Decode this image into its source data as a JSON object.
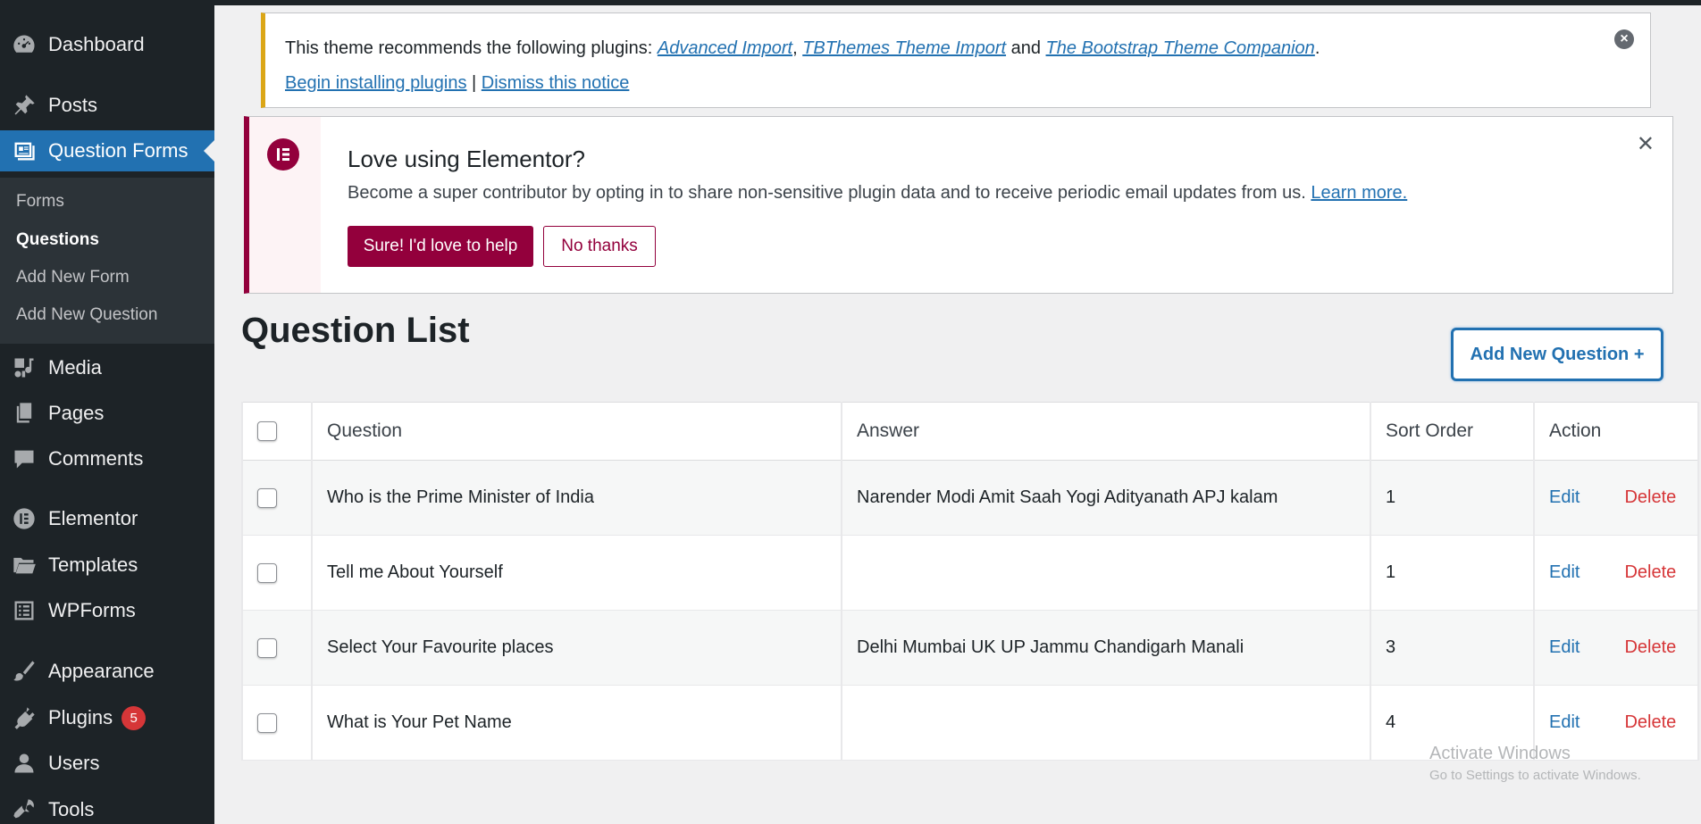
{
  "sidebar": {
    "items": [
      {
        "id": "dashboard",
        "label": "Dashboard",
        "icon": "dashboard-icon"
      },
      {
        "id": "posts",
        "label": "Posts",
        "icon": "pin-icon"
      },
      {
        "id": "question-forms",
        "label": "Question Forms",
        "icon": "forms-icon",
        "active": true
      },
      {
        "id": "media",
        "label": "Media",
        "icon": "media-icon"
      },
      {
        "id": "pages",
        "label": "Pages",
        "icon": "pages-icon"
      },
      {
        "id": "comments",
        "label": "Comments",
        "icon": "comment-icon"
      },
      {
        "id": "elementor",
        "label": "Elementor",
        "icon": "elementor-icon"
      },
      {
        "id": "templates",
        "label": "Templates",
        "icon": "folder-icon"
      },
      {
        "id": "wpforms",
        "label": "WPForms",
        "icon": "wpforms-icon"
      },
      {
        "id": "appearance",
        "label": "Appearance",
        "icon": "brush-icon"
      },
      {
        "id": "plugins",
        "label": "Plugins",
        "icon": "plug-icon",
        "badge": "5"
      },
      {
        "id": "users",
        "label": "Users",
        "icon": "user-icon"
      },
      {
        "id": "tools",
        "label": "Tools",
        "icon": "wrench-icon"
      }
    ],
    "submenu": [
      {
        "label": "Forms"
      },
      {
        "label": "Questions",
        "current": true
      },
      {
        "label": "Add New Form"
      },
      {
        "label": "Add New Question"
      }
    ]
  },
  "theme_notice": {
    "prefix": "This theme recommends the following plugins: ",
    "plugin1": "Advanced Import",
    "sep1": ", ",
    "plugin2": "TBThemes Theme Import",
    "sep2": " and ",
    "plugin3": "The Bootstrap Theme Companion",
    "end": ".",
    "begin_link": "Begin installing plugins",
    "pipe": " | ",
    "dismiss_link": "Dismiss this notice"
  },
  "elementor_notice": {
    "title": "Love using Elementor?",
    "description": "Become a super contributor by opting in to share non-sensitive plugin data and to receive periodic email updates from us. ",
    "learn_more": "Learn more.",
    "yes_button": "Sure! I'd love to help",
    "no_button": "No thanks"
  },
  "page": {
    "title": "Question List",
    "add_button": "Add New Question +"
  },
  "table": {
    "headers": {
      "question": "Question",
      "answer": "Answer",
      "sort": "Sort Order",
      "action": "Action"
    },
    "edit_label": "Edit",
    "delete_label": "Delete",
    "rows": [
      {
        "question": "Who is the Prime Minister of India",
        "answer": "Narender Modi Amit Saah Yogi Adityanath APJ kalam",
        "sort": "1"
      },
      {
        "question": "Tell me About Yourself",
        "answer": "",
        "sort": "1"
      },
      {
        "question": "Select Your Favourite places",
        "answer": "Delhi Mumbai UK UP Jammu Chandigarh Manali",
        "sort": "3"
      },
      {
        "question": "What is Your Pet Name",
        "answer": "",
        "sort": "4"
      }
    ]
  },
  "watermark": {
    "line1": "Activate Windows",
    "line2": "Go to Settings to activate Windows."
  },
  "colors": {
    "sidebar_bg": "#1d2327",
    "accent": "#2271b1",
    "elementor": "#93003c",
    "delete": "#d63638",
    "notice_warning": "#dba617"
  }
}
